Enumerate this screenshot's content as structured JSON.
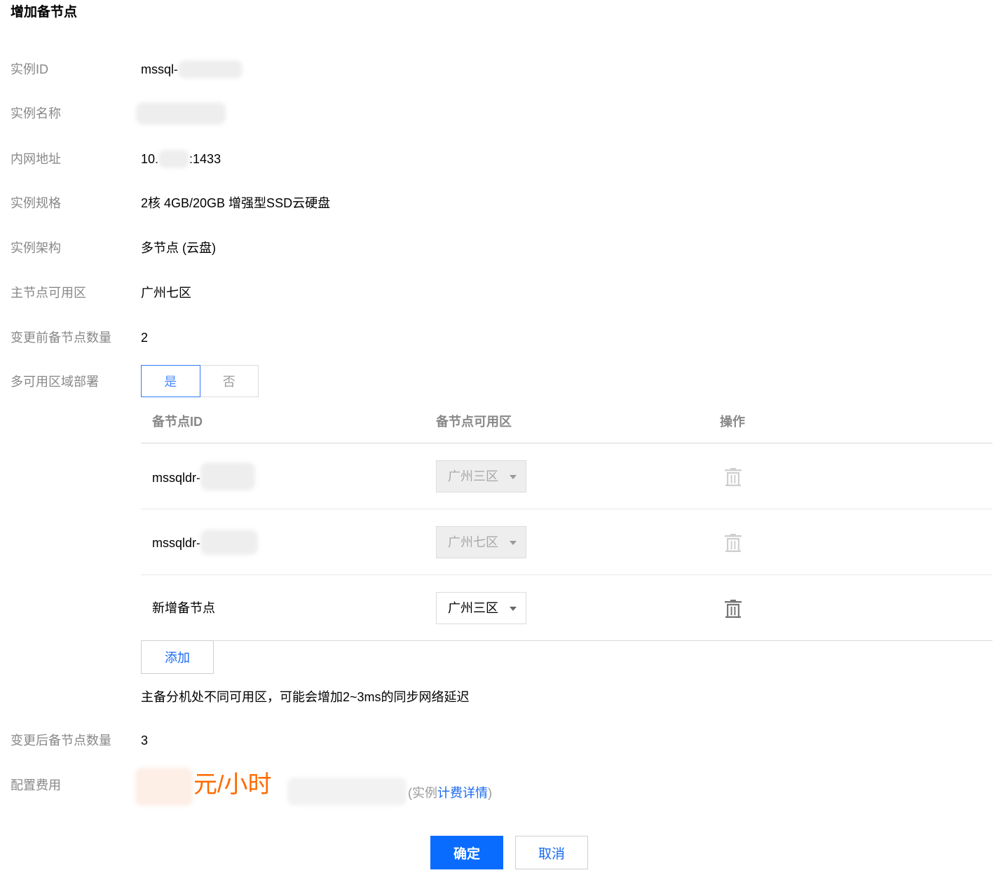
{
  "dialog": {
    "title": "增加备节点"
  },
  "fields": {
    "instance_id": {
      "label": "实例ID",
      "value": "mssql-"
    },
    "instance_name": {
      "label": "实例名称"
    },
    "private_address": {
      "label": "内网地址",
      "value_prefix": "10.",
      "value_suffix": ":1433"
    },
    "spec": {
      "label": "实例规格",
      "value": "2核 4GB/20GB 增强型SSD云硬盘"
    },
    "architecture": {
      "label": "实例架构",
      "value": "多节点 (云盘)"
    },
    "primary_zone": {
      "label": "主节点可用区",
      "value": "广州七区"
    },
    "replicas_before": {
      "label": "变更前备节点数量",
      "value": "2"
    },
    "multi_az": {
      "label": "多可用区域部署",
      "options": [
        "是",
        "否"
      ],
      "selected": "是"
    },
    "replicas_after": {
      "label": "变更后备节点数量",
      "value": "3"
    },
    "fee": {
      "label": "配置费用",
      "unit": "元/小时",
      "detail_prefix": "(实例",
      "detail_link": "计费详情",
      "detail_suffix": ")"
    }
  },
  "replica_table": {
    "headers": [
      "备节点ID",
      "备节点可用区",
      "操作"
    ],
    "rows": [
      {
        "id": "mssqldr-",
        "zone": "广州三区",
        "disabled": true
      },
      {
        "id": "mssqldr-",
        "zone": "广州七区",
        "disabled": true
      },
      {
        "id": "新增备节点",
        "zone": "广州三区",
        "disabled": false
      }
    ],
    "add_label": "添加",
    "note": "主备分机处不同可用区，可能会增加2~3ms的同步网络延迟"
  },
  "actions": {
    "confirm_label": "确定",
    "cancel_label": "取消"
  },
  "colors": {
    "primary": "#0a6cff",
    "link": "#1a6af0",
    "price": "#ff6a00",
    "label": "#888888"
  },
  "icons": {
    "delete": "trash-icon",
    "dropdown": "caret-down-icon"
  }
}
